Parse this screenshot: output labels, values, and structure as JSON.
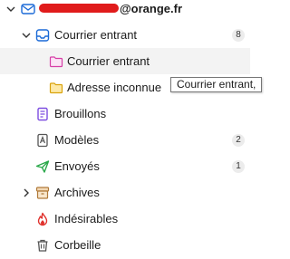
{
  "account": {
    "email_suffix": "@orange.fr",
    "children": [
      {
        "label": "Courrier entrant",
        "count": "8"
      }
    ]
  },
  "inbox_children": [
    {
      "label": "Courrier entrant"
    },
    {
      "label": "Adresse inconnue"
    }
  ],
  "folders": [
    {
      "label": "Brouillons",
      "count": ""
    },
    {
      "label": "Modèles",
      "count": "2"
    },
    {
      "label": "Envoyés",
      "count": "1"
    },
    {
      "label": "Archives",
      "count": ""
    },
    {
      "label": "Indésirables",
      "count": ""
    },
    {
      "label": "Corbeille",
      "count": ""
    }
  ],
  "tooltip": {
    "text": "Courrier entrant, "
  },
  "colors": {
    "accent_blue": "#1b6ad7",
    "sent_green": "#2aa84a",
    "junk_red": "#e0312c",
    "drafts_purple": "#7d4de0",
    "selected_bg": "#f3f3f3"
  },
  "icons": {
    "account": "account-mail-icon",
    "inbox": "inbox-icon",
    "subfolder_pink": "folder-icon",
    "subfolder_yellow": "folder-icon",
    "drafts": "drafts-icon",
    "templates": "templates-icon",
    "sent": "send-icon",
    "archives": "archive-icon",
    "junk": "flame-icon",
    "trash": "trash-icon"
  }
}
